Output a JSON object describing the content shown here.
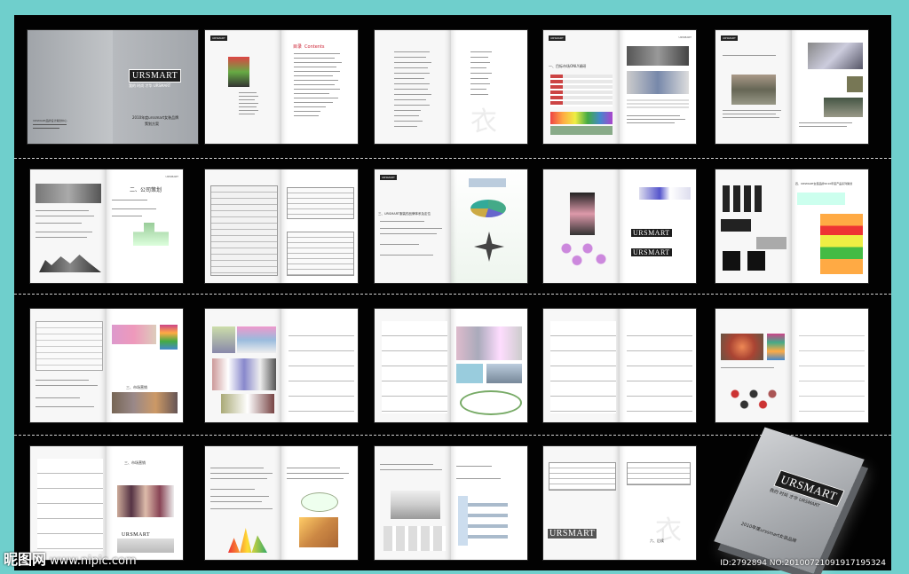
{
  "brochure": {
    "brand": "URSMART",
    "brand_slogan": "我的 时尚 才华 URSMART",
    "cover_title": "2010年度urssmart女装品牌",
    "cover_subtitle": "策划方案",
    "cover_credits": "URSMART品牌设计策划中心",
    "toc_title": "目录",
    "toc_title_en": "Contents",
    "section_one": "一、目标市场ONLY调研",
    "section_two": "二、公司策划",
    "section_three": "三、URSMART服装的品牌体系及定位",
    "section_four": "四、URSMART女装品牌2010年度产品系列策划",
    "section_market": "三、市场营销",
    "section_six": "六、后续",
    "decor_char": "衣"
  },
  "footer": {
    "watermark": "昵图网",
    "watermark_url": "www.nipic.com",
    "image_id": "ID:2792894 NO:20100721091917195324"
  },
  "colors": {
    "background": "#6fcfcc",
    "sheet": "#020202",
    "cover_grey": "#b5b8bc",
    "accent_red": "#cc2233"
  }
}
